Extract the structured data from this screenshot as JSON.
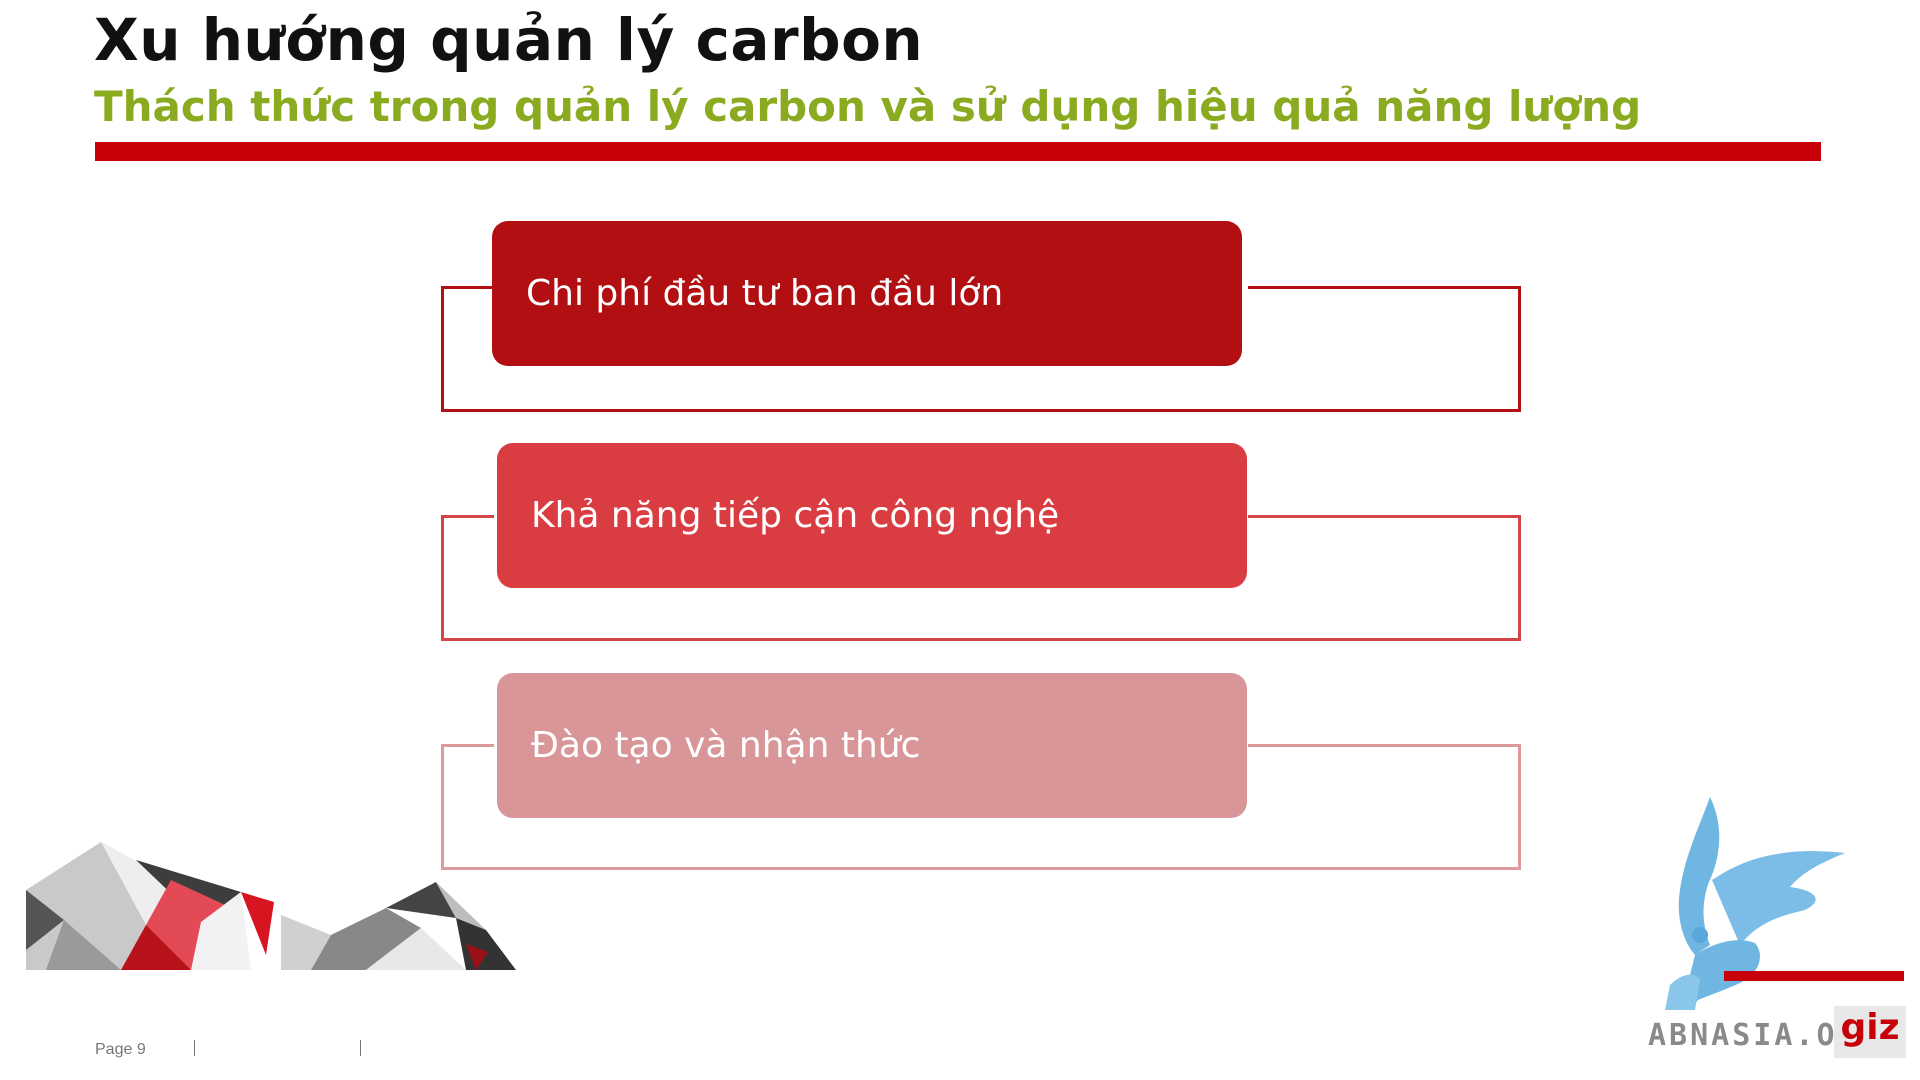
{
  "slide": {
    "title": "Xu hướng quản lý carbon",
    "subtitle": "Thách thức trong quản lý carbon và sử dụng hiệu quả năng lượng"
  },
  "challenges": [
    {
      "label": "Chi phí đầu tư ban đầu lớn",
      "color": "#b10f12",
      "frame_color": "#b10f12"
    },
    {
      "label": "Khả năng tiếp cận công nghệ",
      "color": "#d93d42",
      "frame_color": "#d4454a"
    },
    {
      "label": "Đào tạo và nhận thức",
      "color": "#d99699",
      "frame_color": "#dc9a9d"
    }
  ],
  "footer": {
    "page_label": "Page 9"
  },
  "logo": {
    "watermark": "ABNASIA.ORG",
    "giz": "giz"
  },
  "colors": {
    "accent_red": "#c8000a",
    "subtitle_green": "#8aab1f",
    "logo_blue": "#6fb6e3"
  },
  "icons": {
    "decoration": "polygon-mountain-graphic",
    "logo": "griffin-logo"
  }
}
